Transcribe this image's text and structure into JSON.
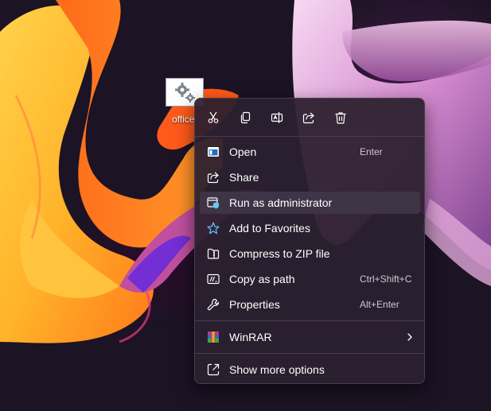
{
  "desktop": {
    "icon_label": "office"
  },
  "menu": {
    "toolbar": [
      {
        "name": "cut-icon",
        "label": "Cut"
      },
      {
        "name": "copy-icon",
        "label": "Copy"
      },
      {
        "name": "rename-icon",
        "label": "Rename"
      },
      {
        "name": "share-icon",
        "label": "Share"
      },
      {
        "name": "delete-icon",
        "label": "Delete"
      }
    ],
    "items": {
      "open": {
        "label": "Open",
        "shortcut": "Enter",
        "icon": "open-window-icon"
      },
      "share": {
        "label": "Share",
        "icon": "share-icon"
      },
      "run_admin": {
        "label": "Run as administrator",
        "icon": "shield-window-icon"
      },
      "favorites": {
        "label": "Add to Favorites",
        "icon": "star-icon"
      },
      "zip": {
        "label": "Compress to ZIP file",
        "icon": "zip-folder-icon"
      },
      "copy_path": {
        "label": "Copy as path",
        "shortcut": "Ctrl+Shift+C",
        "icon": "path-icon"
      },
      "properties": {
        "label": "Properties",
        "shortcut": "Alt+Enter",
        "icon": "wrench-icon"
      },
      "winrar": {
        "label": "WinRAR",
        "icon": "winrar-icon"
      },
      "more": {
        "label": "Show more options",
        "icon": "expand-icon"
      }
    }
  },
  "colors": {
    "accent": "#60cdff",
    "menu_bg": "#2c202f",
    "hover_bg": "#3f3445"
  }
}
